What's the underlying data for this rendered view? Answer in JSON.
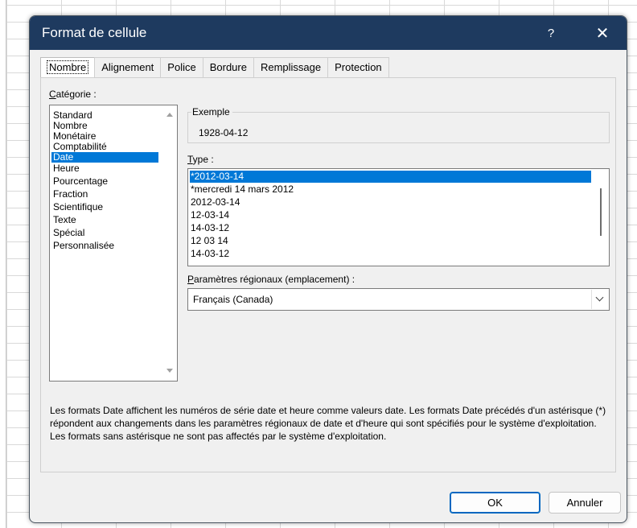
{
  "dialog": {
    "title": "Format de cellule",
    "help_label": "?",
    "close_label": "✕"
  },
  "tabs": [
    {
      "label": "Nombre",
      "active": true
    },
    {
      "label": "Alignement",
      "active": false
    },
    {
      "label": "Police",
      "active": false
    },
    {
      "label": "Bordure",
      "active": false
    },
    {
      "label": "Remplissage",
      "active": false
    },
    {
      "label": "Protection",
      "active": false
    }
  ],
  "category": {
    "label_access_key": "C",
    "label_rest": "atégorie :",
    "items": [
      "Standard",
      "Nombre",
      "Monétaire",
      "Comptabilité",
      "Date",
      "Heure",
      "Pourcentage",
      "Fraction",
      "Scientifique",
      "Texte",
      "Spécial",
      "Personnalisée"
    ],
    "selected": "Date"
  },
  "example": {
    "legend": "Exemple",
    "value": "1928-04-12"
  },
  "type": {
    "label_access_key": "T",
    "label_rest": "ype :",
    "items": [
      "*2012-03-14",
      "*mercredi 14 mars 2012",
      "2012-03-14",
      "12-03-14",
      "14-03-12",
      "12 03 14",
      "14-03-12"
    ],
    "selected": "*2012-03-14"
  },
  "locale": {
    "label_access_key": "P",
    "label_rest": "aramètres régionaux (emplacement) :",
    "value": "Français (Canada)"
  },
  "description": "Les formats Date affichent les numéros de série date et heure comme valeurs date. Les formats Date précédés d'un astérisque (*) répondent aux changements dans les paramètres régionaux de date et d'heure qui sont spécifiés pour le système d'exploitation. Les formats sans astérisque ne sont pas affectés par le système d'exploitation.",
  "buttons": {
    "ok": "OK",
    "cancel": "Annuler"
  },
  "colors": {
    "titlebar": "#1e3a5f",
    "selection": "#0078d7",
    "dialog_bg": "#f0f0f0"
  }
}
